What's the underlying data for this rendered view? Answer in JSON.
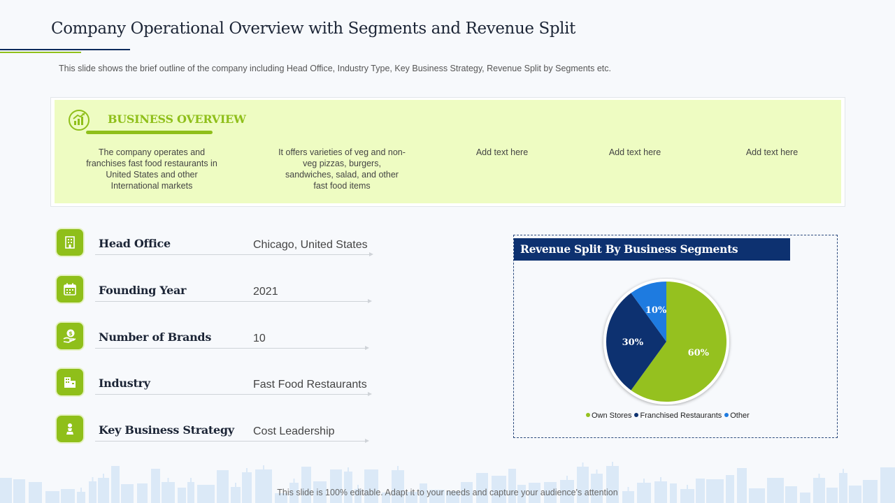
{
  "header": {
    "title": "Company Operational Overview with Segments and Revenue Split",
    "subtitle": "This slide shows the brief outline of the company including Head Office, Industry Type, Key Business Strategy, Revenue  Split by Segments etc."
  },
  "overview": {
    "heading": "BUSINESS OVERVIEW",
    "icon": "growth-chart-icon",
    "columns": [
      "The company operates and franchises fast food restaurants in United States and other International  markets",
      "It offers varieties of veg and non-veg  pizzas, burgers, sandwiches, salad, and other fast food items",
      "Add text here",
      "Add text here",
      "Add text here"
    ]
  },
  "details": [
    {
      "label": "Head Office",
      "value": "Chicago, United States",
      "icon": "building-icon"
    },
    {
      "label": "Founding Year",
      "value": "2021",
      "icon": "calendar-icon"
    },
    {
      "label": "Number of Brands",
      "value": "10",
      "icon": "money-hand-icon"
    },
    {
      "label": "Industry",
      "value": "Fast Food Restaurants",
      "icon": "factory-icon"
    },
    {
      "label": "Key Business Strategy",
      "value": "Cost Leadership",
      "icon": "chess-pawn-icon"
    }
  ],
  "chart_data": {
    "type": "pie",
    "title": "Revenue Split By Business Segments",
    "slices": [
      {
        "name": "Own Stores",
        "value": 60,
        "label": "60%",
        "color": "#95c11f"
      },
      {
        "name": "Franchised Restaurants",
        "value": 30,
        "label": "30%",
        "color": "#0d3170"
      },
      {
        "name": "Other",
        "value": 10,
        "label": "10%",
        "color": "#1e7be0"
      }
    ],
    "legend_position": "bottom"
  },
  "footer": {
    "note": "This slide is 100% editable. Adapt it to your needs and capture your audience's attention"
  },
  "colors": {
    "accent_green": "#8fbf1a",
    "navy": "#0d3170",
    "overview_bg": "#eefcc2"
  }
}
